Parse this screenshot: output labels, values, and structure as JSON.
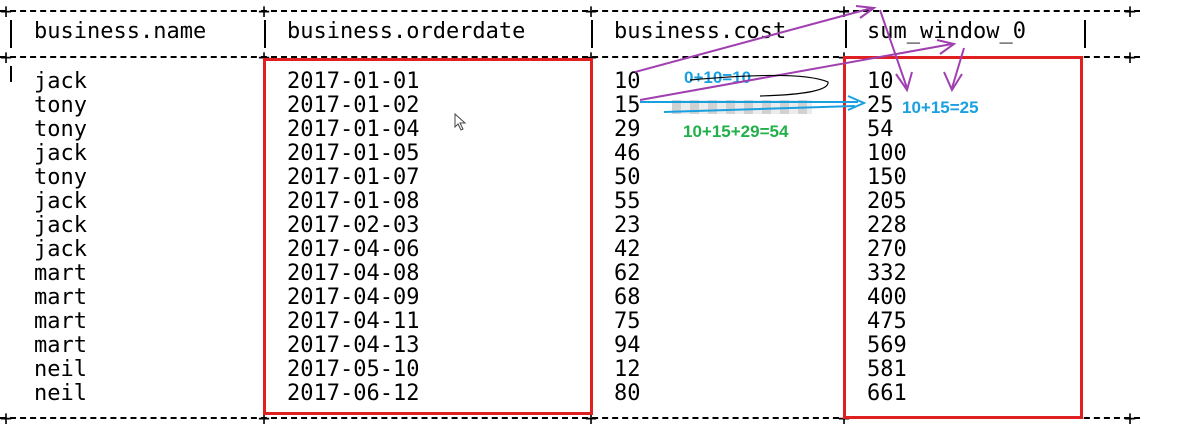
{
  "table": {
    "headers": [
      "business.name",
      "business.orderdate",
      "business.cost",
      "sum_window_0"
    ],
    "rows": [
      {
        "name": "jack",
        "orderdate": "2017-01-01",
        "cost": "10",
        "sum": "10"
      },
      {
        "name": "tony",
        "orderdate": "2017-01-02",
        "cost": "15",
        "sum": "25"
      },
      {
        "name": "tony",
        "orderdate": "2017-01-04",
        "cost": "29",
        "sum": "54"
      },
      {
        "name": "jack",
        "orderdate": "2017-01-05",
        "cost": "46",
        "sum": "100"
      },
      {
        "name": "tony",
        "orderdate": "2017-01-07",
        "cost": "50",
        "sum": "150"
      },
      {
        "name": "jack",
        "orderdate": "2017-01-08",
        "cost": "55",
        "sum": "205"
      },
      {
        "name": "jack",
        "orderdate": "2017-02-03",
        "cost": "23",
        "sum": "228"
      },
      {
        "name": "jack",
        "orderdate": "2017-04-06",
        "cost": "42",
        "sum": "270"
      },
      {
        "name": "mart",
        "orderdate": "2017-04-08",
        "cost": "62",
        "sum": "332"
      },
      {
        "name": "mart",
        "orderdate": "2017-04-09",
        "cost": "68",
        "sum": "400"
      },
      {
        "name": "mart",
        "orderdate": "2017-04-11",
        "cost": "75",
        "sum": "475"
      },
      {
        "name": "mart",
        "orderdate": "2017-04-13",
        "cost": "94",
        "sum": "569"
      },
      {
        "name": "neil",
        "orderdate": "2017-05-10",
        "cost": "12",
        "sum": "581"
      },
      {
        "name": "neil",
        "orderdate": "2017-06-12",
        "cost": "80",
        "sum": "661"
      }
    ]
  },
  "annotations": {
    "first": "0+10=10",
    "second": "10+15=25",
    "third": "10+15+29=54"
  },
  "colors": {
    "red_box": "#e02020",
    "blue_annotation": "#1aa0e0",
    "green_annotation": "#22b04a",
    "purple_arrow": "#a040b0"
  },
  "icons": {
    "cursor": "mouse-pointer-icon"
  }
}
